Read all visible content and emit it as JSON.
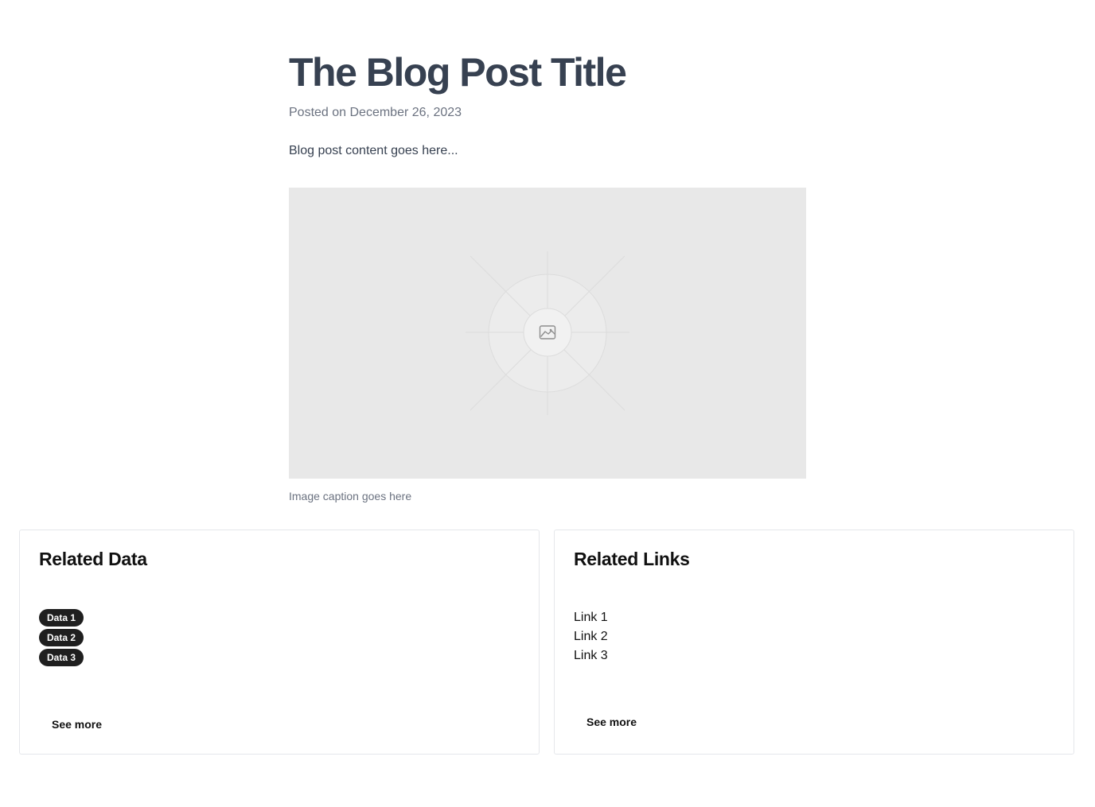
{
  "post": {
    "title": "The Blog Post Title",
    "meta": "Posted on December 26, 2023",
    "body": "Blog post content goes here...",
    "image_icon": "image-placeholder-icon",
    "caption": "Image caption goes here"
  },
  "related_data": {
    "title": "Related Data",
    "badges": [
      "Data 1",
      "Data 2",
      "Data 3"
    ],
    "see_more": "See more"
  },
  "related_links": {
    "title": "Related Links",
    "links": [
      "Link 1",
      "Link 2",
      "Link 3"
    ],
    "see_more": "See more"
  },
  "colors": {
    "title": "#374151",
    "muted": "#6b7280",
    "badge_bg": "#1f1f1f",
    "placeholder_bg": "#e8e8e8",
    "card_border": "#e5e7eb"
  }
}
